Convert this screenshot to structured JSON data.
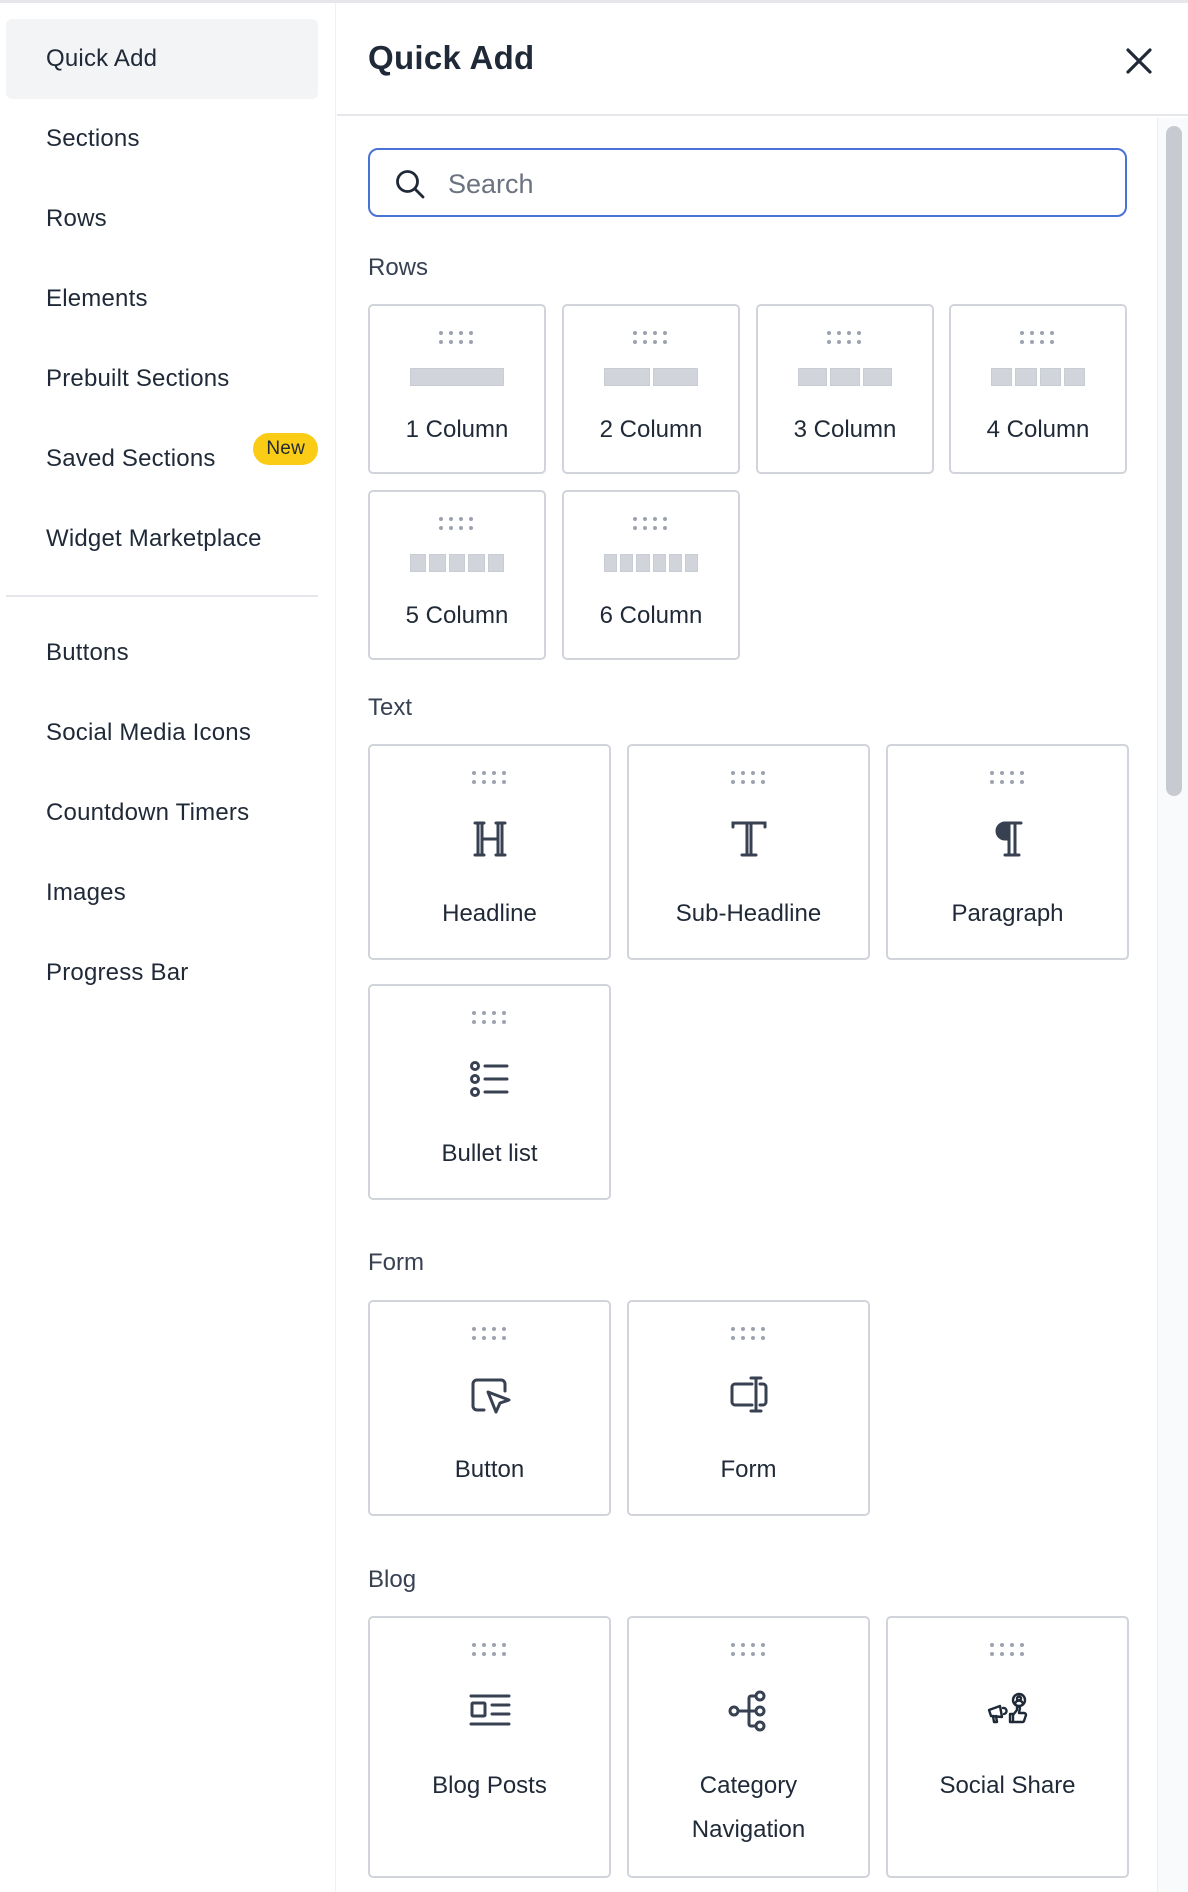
{
  "sidebar": {
    "items": [
      {
        "label": "Quick Add",
        "active": true
      },
      {
        "label": "Sections"
      },
      {
        "label": "Rows"
      },
      {
        "label": "Elements"
      },
      {
        "label": "Prebuilt Sections"
      },
      {
        "label": "Saved Sections",
        "badge": "New"
      },
      {
        "label": "Widget Marketplace"
      },
      {
        "label": "Buttons"
      },
      {
        "label": "Social Media Icons"
      },
      {
        "label": "Countdown Timers"
      },
      {
        "label": "Images"
      },
      {
        "label": "Progress Bar"
      }
    ]
  },
  "panel": {
    "title": "Quick Add",
    "close_icon": "close-icon"
  },
  "search": {
    "placeholder": "Search",
    "value": ""
  },
  "sections": {
    "rows": {
      "label": "Rows",
      "items": [
        "1 Column",
        "2 Column",
        "3 Column",
        "4 Column",
        "5 Column",
        "6 Column"
      ]
    },
    "text": {
      "label": "Text",
      "items": [
        {
          "label": "Headline",
          "icon": "headline-icon"
        },
        {
          "label": "Sub-Headline",
          "icon": "sub-headline-icon"
        },
        {
          "label": "Paragraph",
          "icon": "paragraph-icon"
        },
        {
          "label": "Bullet list",
          "icon": "bullet-list-icon"
        }
      ]
    },
    "form": {
      "label": "Form",
      "items": [
        {
          "label": "Button",
          "icon": "button-cursor-icon"
        },
        {
          "label": "Form",
          "icon": "form-input-icon"
        }
      ]
    },
    "blog": {
      "label": "Blog",
      "items": [
        {
          "label": "Blog Posts",
          "icon": "blog-posts-icon"
        },
        {
          "label": "Category",
          "label2": "Navigation",
          "icon": "category-navigation-icon"
        },
        {
          "label": "Social Share",
          "icon": "social-share-icon"
        }
      ]
    }
  },
  "colors": {
    "accent": "#4a72d6",
    "badge": "#facc15",
    "border": "#d1d5db",
    "active_bg": "#f3f4f6"
  }
}
